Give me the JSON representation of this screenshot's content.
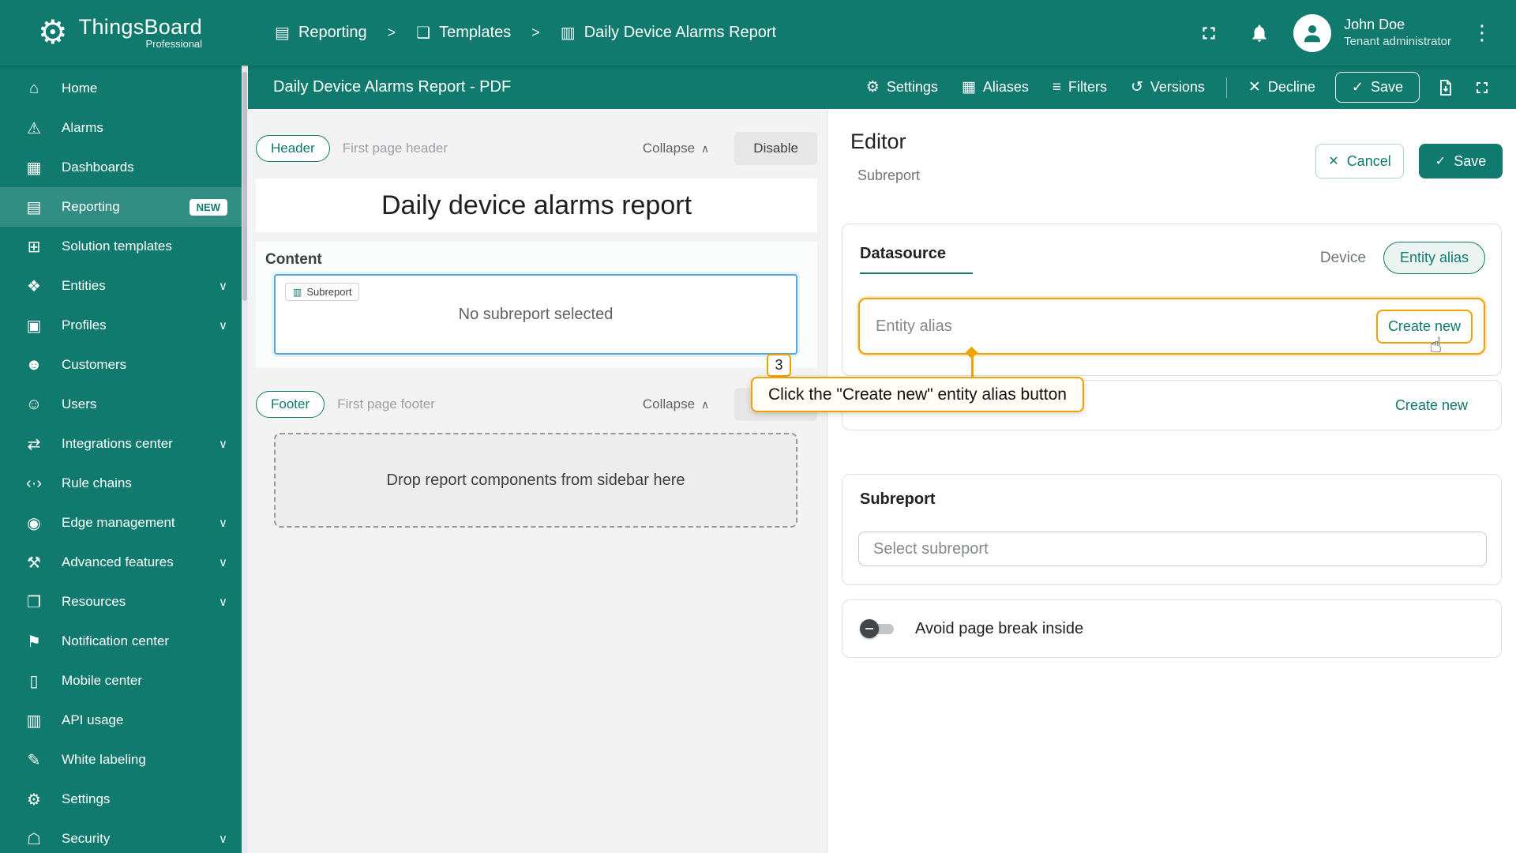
{
  "colors": {
    "primary": "#0f7a6d",
    "accent_orange": "#f0a202",
    "selection_blue": "#54a7e0"
  },
  "icons": {
    "logo": "⚙",
    "breadcrumb_separator": ">",
    "kebab": "⋮",
    "settings": "⚙",
    "aliases": "▦",
    "filters": "≡",
    "versions": "↺",
    "close": "✕",
    "check": "✓",
    "chevron_up": "∧",
    "chevron_down": "∨",
    "subreport_tag": "▥",
    "hand_pointer": "☝"
  },
  "topbar": {
    "brand": "ThingsBoard",
    "brand_sub": "Professional",
    "breadcrumb": [
      {
        "glyph": "▤",
        "label": "Reporting"
      },
      {
        "glyph": "❏",
        "label": "Templates"
      },
      {
        "glyph": "▥",
        "label": "Daily Device Alarms Report"
      }
    ],
    "user_name": "John Doe",
    "user_role": "Tenant administrator"
  },
  "sidebar": {
    "items": [
      {
        "glyph": "⌂",
        "label": "Home"
      },
      {
        "glyph": "⚠",
        "label": "Alarms"
      },
      {
        "glyph": "▦",
        "label": "Dashboards"
      },
      {
        "glyph": "▤",
        "label": "Reporting",
        "badge": "NEW",
        "active": true
      },
      {
        "glyph": "⊞",
        "label": "Solution templates"
      },
      {
        "glyph": "❖",
        "label": "Entities",
        "expandable": true
      },
      {
        "glyph": "▣",
        "label": "Profiles",
        "expandable": true
      },
      {
        "glyph": "☻",
        "label": "Customers"
      },
      {
        "glyph": "☺",
        "label": "Users"
      },
      {
        "glyph": "⇄",
        "label": "Integrations center",
        "expandable": true
      },
      {
        "glyph": "‹·›",
        "label": "Rule chains"
      },
      {
        "glyph": "◉",
        "label": "Edge management",
        "expandable": true
      },
      {
        "glyph": "⚒",
        "label": "Advanced features",
        "expandable": true
      },
      {
        "glyph": "❐",
        "label": "Resources",
        "expandable": true
      },
      {
        "glyph": "⚑",
        "label": "Notification center"
      },
      {
        "glyph": "▯",
        "label": "Mobile center"
      },
      {
        "glyph": "▥",
        "label": "API usage"
      },
      {
        "glyph": "✎",
        "label": "White labeling"
      },
      {
        "glyph": "⚙",
        "label": "Settings"
      },
      {
        "glyph": "☖",
        "label": "Security",
        "expandable": true
      }
    ]
  },
  "subheader": {
    "title": "Daily Device Alarms Report - PDF",
    "settings": "Settings",
    "aliases": "Aliases",
    "filters": "Filters",
    "versions": "Versions",
    "decline": "Decline",
    "save": "Save"
  },
  "canvas": {
    "header_badge": "Header",
    "header_hint": "First page header",
    "collapse": "Collapse",
    "disable": "Disable",
    "report_title": "Daily device alarms report",
    "content_label": "Content",
    "component_tag": "Subreport",
    "component_empty": "No subreport selected",
    "footer_badge": "Footer",
    "footer_hint": "First page footer",
    "dropzone": "Drop report components from sidebar here"
  },
  "editor": {
    "title": "Editor",
    "subtitle": "Subreport",
    "cancel": "Cancel",
    "save": "Save",
    "datasource_title": "Datasource",
    "device_option": "Device",
    "entity_alias_option": "Entity alias",
    "alias_placeholder": "Entity alias",
    "create_new": "Create new",
    "create_new_secondary": "Create new",
    "subreport_title": "Subreport",
    "subreport_placeholder": "Select subreport",
    "page_break_label": "Avoid page break inside"
  },
  "annotation": {
    "step": "3",
    "text": "Click the \"Create new\" entity alias button"
  }
}
